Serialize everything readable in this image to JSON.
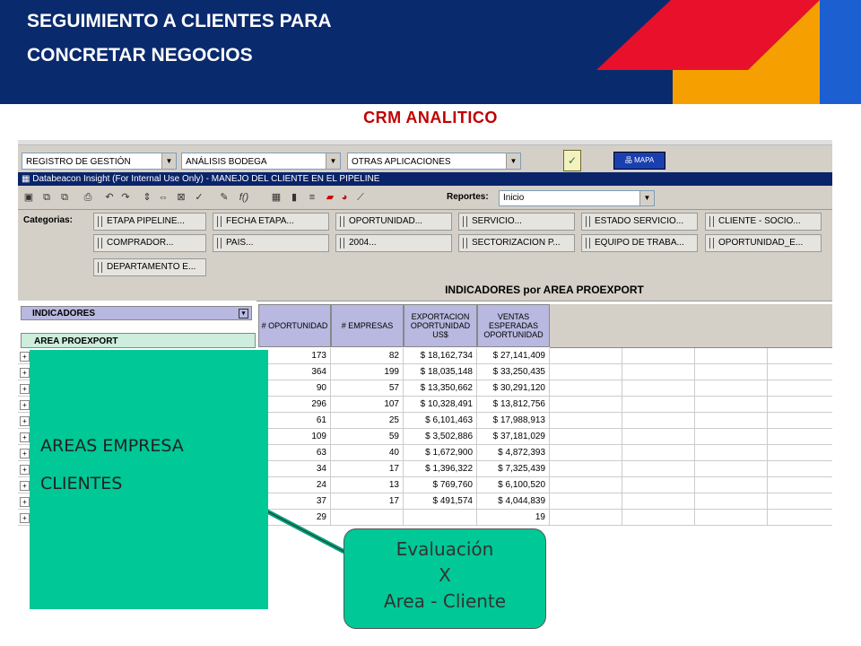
{
  "header": {
    "title_line1": "SEGUIMIENTO A CLIENTES PARA",
    "title_line2": "CONCRETAR NEGOCIOS",
    "colors": {
      "navy": "#0a2a6e",
      "red": "#e8102a",
      "orange": "#f5a000",
      "blue": "#1c5fd1"
    }
  },
  "subtitle": "CRM ANALITICO",
  "app": {
    "top_dropdowns": [
      "REGISTRO DE GESTIÓN",
      "ANÁLISIS BODEGA",
      "OTRAS APLICACIONES"
    ],
    "mapa_label": "MAPA",
    "window_title": "Databeacon Insight (For Internal Use Only) - MANEJO DEL CLIENTE EN EL PIPELINE",
    "reportes_label": "Reportes:",
    "reportes_value": "Inicio",
    "categorias_label": "Categorias:",
    "categories_row1": [
      "ETAPA PIPELINE...",
      "FECHA ETAPA...",
      "OPORTUNIDAD...",
      "SERVICIO...",
      "ESTADO SERVICIO...",
      "CLIENTE - SOCIO..."
    ],
    "categories_row2": [
      "COMPRADOR...",
      "PAIS...",
      "2004...",
      "SECTORIZACION P...",
      "EQUIPO DE TRABA...",
      "OPORTUNIDAD_E..."
    ],
    "categories_row3": [
      "DEPARTAMENTO E..."
    ],
    "indicadores_label": "INDICADORES",
    "area_label": "AREA PROEXPORT",
    "table_title": "INDICADORES por AREA PROEXPORT",
    "columns": [
      "# OPORTUNIDAD",
      "# EMPRESAS",
      "EXPORTACION OPORTUNIDAD US$",
      "VENTAS ESPERADAS OPORTUNIDAD"
    ],
    "rows": [
      [
        "173",
        "82",
        "$ 18,162,734",
        "$ 27,141,409"
      ],
      [
        "364",
        "199",
        "$ 18,035,148",
        "$ 33,250,435"
      ],
      [
        "90",
        "57",
        "$ 13,350,662",
        "$ 30,291,120"
      ],
      [
        "296",
        "107",
        "$ 10,328,491",
        "$ 13,812,756"
      ],
      [
        "61",
        "25",
        "$ 6,101,463",
        "$ 17,988,913"
      ],
      [
        "109",
        "59",
        "$ 3,502,886",
        "$ 37,181,029"
      ],
      [
        "63",
        "40",
        "$ 1,672,900",
        "$ 4,872,393"
      ],
      [
        "34",
        "17",
        "$ 1,396,322",
        "$ 7,325,439"
      ],
      [
        "24",
        "13",
        "$ 769,760",
        "$ 6,100,520"
      ],
      [
        "37",
        "17",
        "$ 491,574",
        "$ 4,044,839"
      ],
      [
        "29",
        "",
        "",
        "19"
      ]
    ]
  },
  "overlay": {
    "line1": "AREAS EMPRESA",
    "line2": "CLIENTES"
  },
  "callout": {
    "line1": "Evaluación",
    "line2": "X",
    "line3": "Area - Cliente"
  }
}
